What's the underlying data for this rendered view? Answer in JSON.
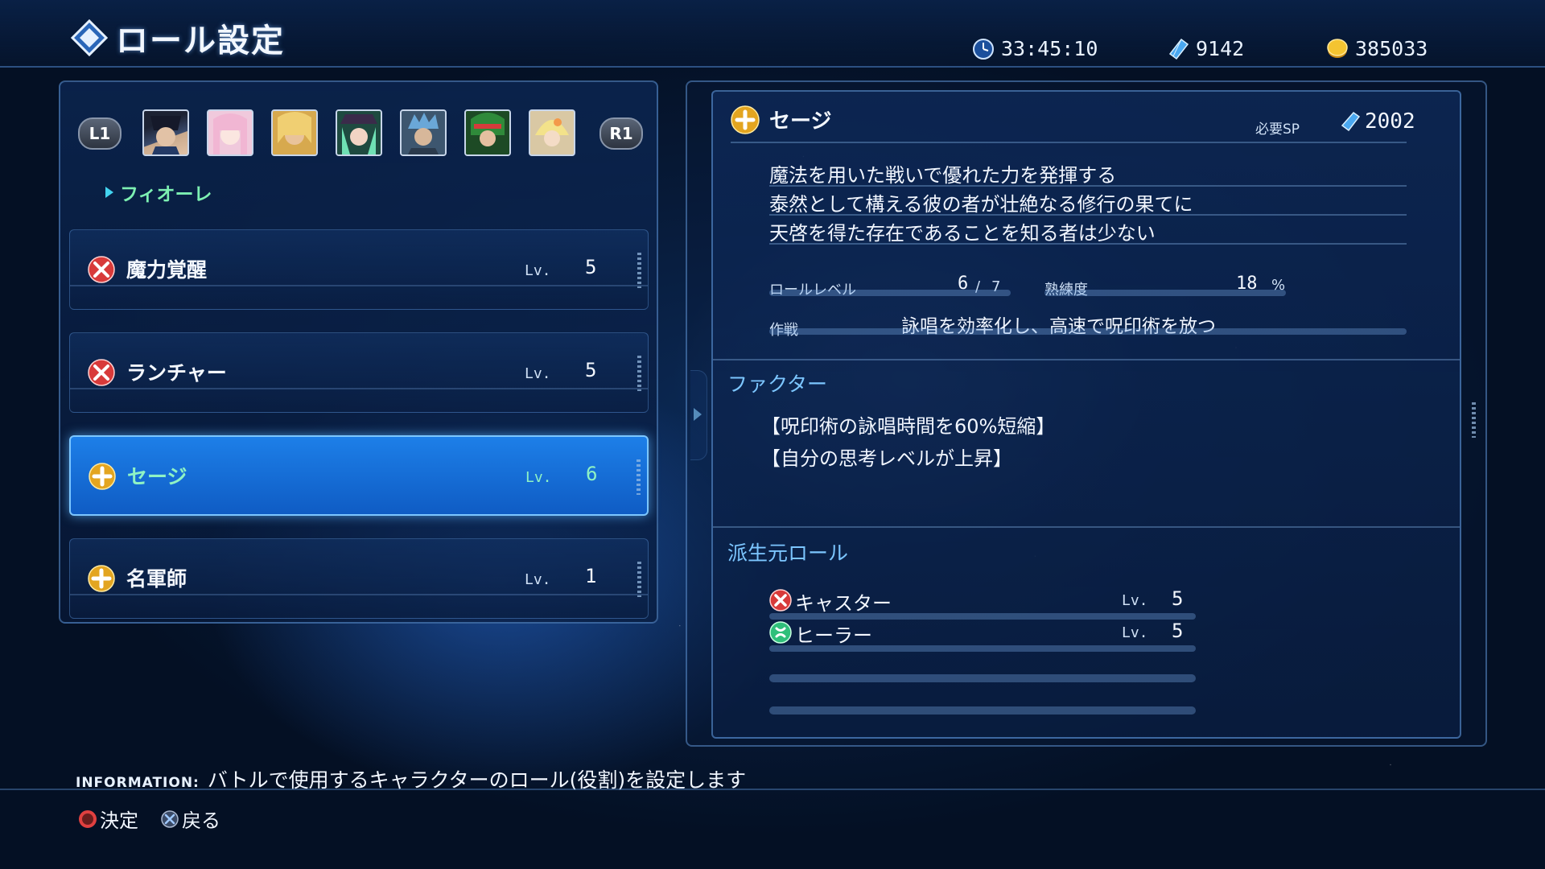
{
  "header": {
    "title": "ロール設定",
    "playtime": "33:45:10",
    "sp": "9142",
    "money": "385033",
    "icons": [
      "clock-icon",
      "sp-crystal-icon",
      "gold-coin-icon"
    ]
  },
  "party": {
    "prev_label": "L1",
    "next_label": "R1",
    "portraits": [
      "character-1",
      "character-2",
      "character-3",
      "character-4",
      "character-5",
      "character-6",
      "character-7"
    ],
    "selected_name": "フィオーレ"
  },
  "roles": [
    {
      "name": "魔力覚醒",
      "lv_label": "Lv.",
      "lv": "5",
      "icon": "attack-role-icon",
      "selected": false
    },
    {
      "name": "ランチャー",
      "lv_label": "Lv.",
      "lv": "5",
      "icon": "attack-role-icon",
      "selected": false
    },
    {
      "name": "セージ",
      "lv_label": "Lv.",
      "lv": "6",
      "icon": "support-role-icon",
      "selected": true
    },
    {
      "name": "名軍師",
      "lv_label": "Lv.",
      "lv": "1",
      "icon": "support-role-icon",
      "selected": false
    }
  ],
  "detail": {
    "name": "セージ",
    "required_sp_label": "必要SP",
    "required_sp": "2002",
    "description": [
      "魔法を用いた戦いで優れた力を発揮する",
      "泰然として構える彼の者が壮絶なる修行の果てに",
      "天啓を得た存在であることを知る者は少ない"
    ],
    "role_level_label": "ロールレベル",
    "role_level": "6",
    "role_level_sep": "/",
    "role_level_max": "7",
    "proficiency_label": "熟練度",
    "proficiency": "18",
    "proficiency_unit": "%",
    "tactic_label": "作戦",
    "tactic": "詠唱を効率化し、高速で呪印術を放つ",
    "factor_title": "ファクター",
    "factors": [
      "【呪印術の詠唱時間を60%短縮】",
      "【自分の思考レベルが上昇】"
    ],
    "derived_title": "派生元ロール",
    "derived": [
      {
        "name": "キャスター",
        "lv_label": "Lv.",
        "lv": "5",
        "icon": "attack-role-icon"
      },
      {
        "name": "ヒーラー",
        "lv_label": "Lv.",
        "lv": "5",
        "icon": "heal-role-icon"
      }
    ]
  },
  "information": {
    "label": "INFORMATION:",
    "text": "バトルで使用するキャラクターのロール(役割)を設定します"
  },
  "footer": {
    "confirm": "決定",
    "back": "戻る"
  },
  "colors": {
    "accent": "#7cc6ff",
    "selected_row": "#1d7fe8",
    "selected_text": "#8ff3c4",
    "attack_icon": "#d83a3a",
    "support_icon": "#e3a520",
    "heal_icon": "#2fbf7a"
  }
}
